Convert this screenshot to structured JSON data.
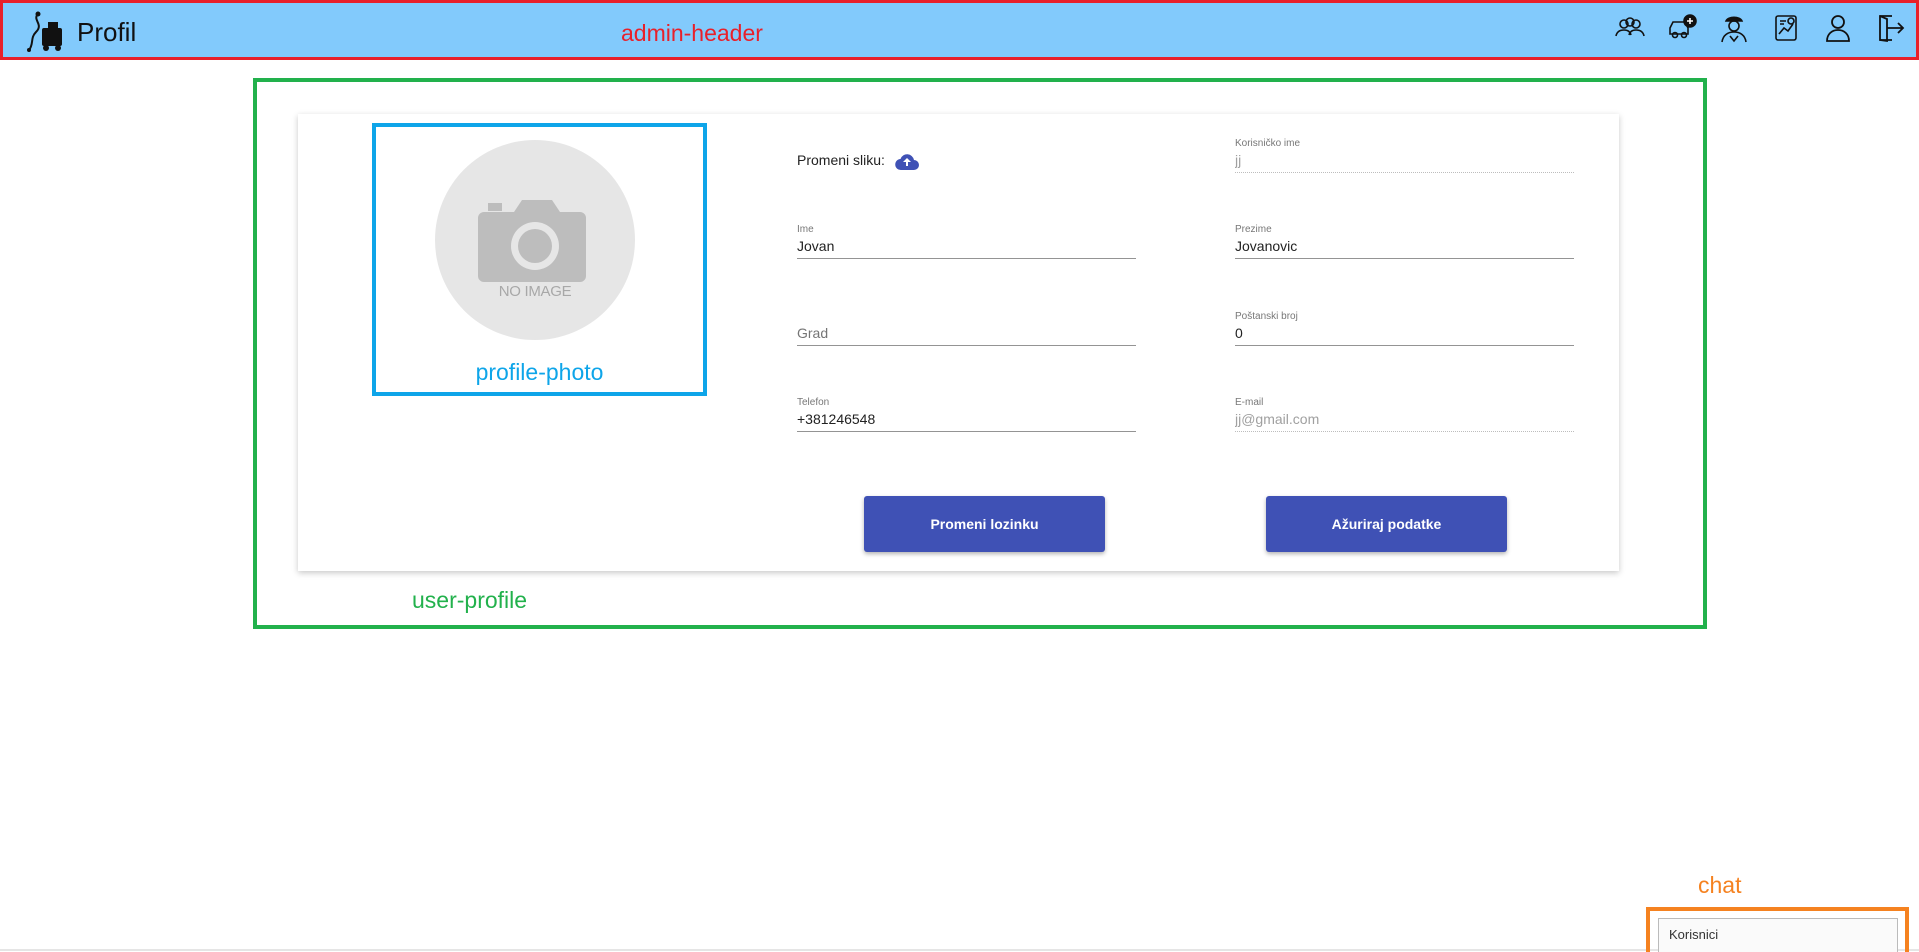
{
  "header": {
    "title": "Profil",
    "overlay_label": "admin-header",
    "icons": [
      "users-group-icon",
      "add-car-icon",
      "driver-icon",
      "report-chart-icon",
      "user-icon",
      "logout-icon"
    ],
    "background_color": "#82cafc"
  },
  "profile": {
    "overlay_label": "user-profile",
    "photo": {
      "overlay_label": "profile-photo",
      "placeholder_text": "NO IMAGE"
    },
    "change_photo_label": "Promeni sliku:",
    "fields": {
      "username": {
        "label": "Korisničko ime",
        "value": "jj"
      },
      "first_name": {
        "label": "Ime",
        "value": "Jovan"
      },
      "last_name": {
        "label": "Prezime",
        "value": "Jovanovic"
      },
      "city": {
        "placeholder": "Grad",
        "value": ""
      },
      "postal_code": {
        "label": "Poštanski broj",
        "value": "0"
      },
      "phone": {
        "label": "Telefon",
        "value": "+381246548"
      },
      "email": {
        "label": "E-mail",
        "value": "jj@gmail.com"
      }
    },
    "buttons": {
      "change_password": "Promeni lozinku",
      "update_data": "Ažuriraj podatke"
    },
    "accent_color": "#3f51b5"
  },
  "chat": {
    "overlay_label": "chat",
    "title": "Korisnici"
  }
}
